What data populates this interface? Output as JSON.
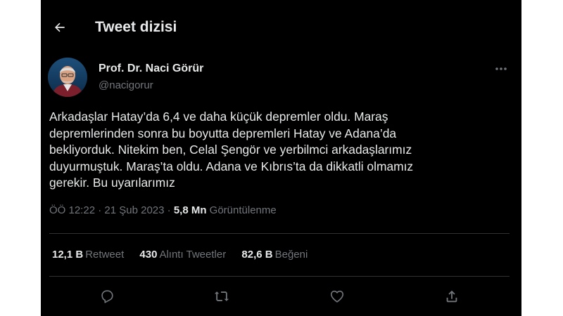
{
  "header": {
    "title": "Tweet dizisi",
    "back_icon": "arrow-left-icon"
  },
  "author": {
    "name": "Prof. Dr. Naci Görür",
    "handle": "@nacigorur",
    "more_icon": "more-dots-icon"
  },
  "tweet": {
    "lines": [
      "Arkadaşlar Hatay’da 6,4 ve daha küçük depremler oldu. Maraş",
      "depremlerinden sonra bu boyutta depremleri Hatay ve Adana’da",
      "bekliyorduk. Nitekim ben, Celal Şengör ve yerbilmci arkadaşlarımız",
      "duyurmuştuk. Maraş’ta oldu. Adana ve Kıbrıs’ta da dikkatli olmamız",
      "gerekir. Bu uyarılarımız"
    ],
    "time": "ÖÖ 12:22",
    "date": "21 Şub 2023",
    "separator": "·",
    "views_count": "5,8 Mn",
    "views_label": "Görüntülenme"
  },
  "stats": {
    "retweets_count": "12,1 B",
    "retweets_label": "Retweet",
    "quotes_count": "430",
    "quotes_label": "Alıntı Tweetler",
    "likes_count": "82,6 B",
    "likes_label": "Beğeni"
  },
  "actions": [
    {
      "icon": "reply-icon"
    },
    {
      "icon": "retweet-icon"
    },
    {
      "icon": "like-icon"
    },
    {
      "icon": "share-icon"
    }
  ],
  "colors": {
    "background": "#000000",
    "text": "#e7e9ea",
    "secondary_text": "#71767b",
    "divider": "#2f3336"
  }
}
